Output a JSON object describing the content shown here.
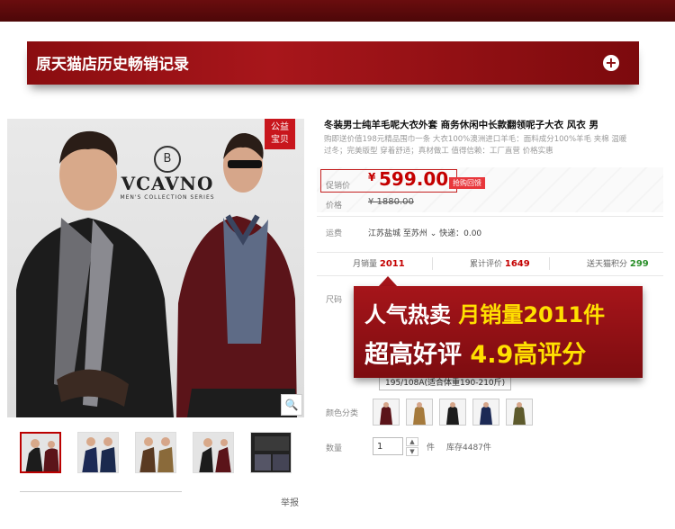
{
  "banner": {
    "title": "原天猫店历史畅销记录"
  },
  "photo": {
    "brand": "VCAVNO",
    "brand_sub": "MEN'S COLLECTION SERIES",
    "emblem": "B",
    "badge_line1": "公益",
    "badge_line2": "宝贝"
  },
  "product": {
    "title": "冬装男士纯羊毛呢大衣外套 商务休闲中长款翻领呢子大衣 风衣 男",
    "subtitle": "购即送价值198元精品围巾一条 大衣100%澳洲进口羊毛：面料成分100%羊毛 夹棉 温暖过冬；完美版型 穿着舒适；真材做工 值得信赖：工厂直营 价格实惠"
  },
  "price": {
    "promo_label": "促销价",
    "currency": "¥",
    "value": "599.00",
    "tag": "抢购回馈",
    "orig_label": "价格",
    "orig_value": "¥ 1880.00"
  },
  "shipping": {
    "label": "运费",
    "text": "江苏盐城 至苏州 ⌄ 快递：0.00"
  },
  "stats": {
    "monthly_label": "月销量",
    "monthly": "2011",
    "reviews_label": "累计评价",
    "reviews": "1649",
    "points_label": "送天猫积分",
    "points": "299"
  },
  "options": {
    "size_label": "尺码",
    "size_option": "195/108A(适合体重190-210斤)",
    "color_label": "颜色分类",
    "qty_label": "数量",
    "qty_value": "1",
    "qty_unit": "件",
    "stock": "库存4487件"
  },
  "promo": {
    "l1a": "人气热卖",
    "l1b": "月销量",
    "l1c": "2011件",
    "l2a": "超高好评",
    "l2b": "4.9高评分"
  },
  "footer": {
    "report": "举报"
  },
  "colors": {
    "brand_red": "#a6151a",
    "price_red": "#c40000",
    "highlight_yellow": "#ffe000"
  }
}
